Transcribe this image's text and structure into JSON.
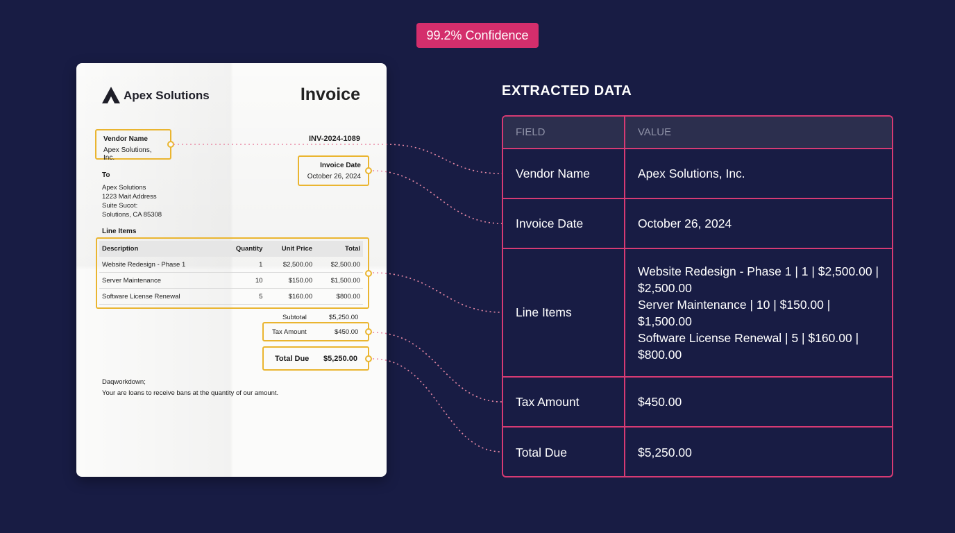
{
  "badge": "99.2% Confidence",
  "invoice": {
    "company": "Apex Solutions",
    "title": "Invoice",
    "number": "INV-2024-1089",
    "vendor_label": "Vendor Name",
    "vendor_value": "Apex Solutions, Inc.",
    "date_label": "Invoice Date",
    "date_value": "October 26, 2024",
    "to_label": "To",
    "to_lines": [
      "Apex Solutions",
      "1223 Mait Address",
      "Suite Sucot:",
      "Solutions, CA 85308"
    ],
    "line_items_label": "Line Items",
    "columns": [
      "Description",
      "Quantity",
      "Unit Price",
      "Total"
    ],
    "rows": [
      [
        "Website Redesign - Phase 1",
        "1",
        "$2,500.00",
        "$2,500.00"
      ],
      [
        "Server Maintenance",
        "10",
        "$150.00",
        "$1,500.00"
      ],
      [
        "Software License Renewal",
        "5",
        "$160.00",
        "$800.00"
      ]
    ],
    "subtotal_label": "Subtotal",
    "subtotal_value": "$5,250.00",
    "tax_label": "Tax Amount",
    "tax_value": "$450.00",
    "total_label": "Total Due",
    "total_value": "$5,250.00",
    "footer1": "Daqworkdown;",
    "footer2": "Your are loans to receive bans at the quantity of our amount."
  },
  "extracted": {
    "title": "EXTRACTED DATA",
    "header": [
      "FIELD",
      "VALUE"
    ],
    "rows": [
      {
        "field": "Vendor Name",
        "value": [
          "Apex Solutions, Inc."
        ]
      },
      {
        "field": "Invoice Date",
        "value": [
          "October 26, 2024"
        ]
      },
      {
        "field": "Line Items",
        "value": [
          "Website Redesign - Phase 1 | 1 | $2,500.00 | $2,500.00",
          "Server Maintenance | 10 | $150.00 | $1,500.00",
          "Software License Renewal | 5 | $160.00 | $800.00"
        ]
      },
      {
        "field": "Tax Amount",
        "value": [
          "$450.00"
        ]
      },
      {
        "field": "Total Due",
        "value": [
          "$5,250.00"
        ]
      }
    ]
  },
  "colors": {
    "background": "#181c44",
    "accent": "#d42e6c",
    "highlight": "#eab530"
  }
}
